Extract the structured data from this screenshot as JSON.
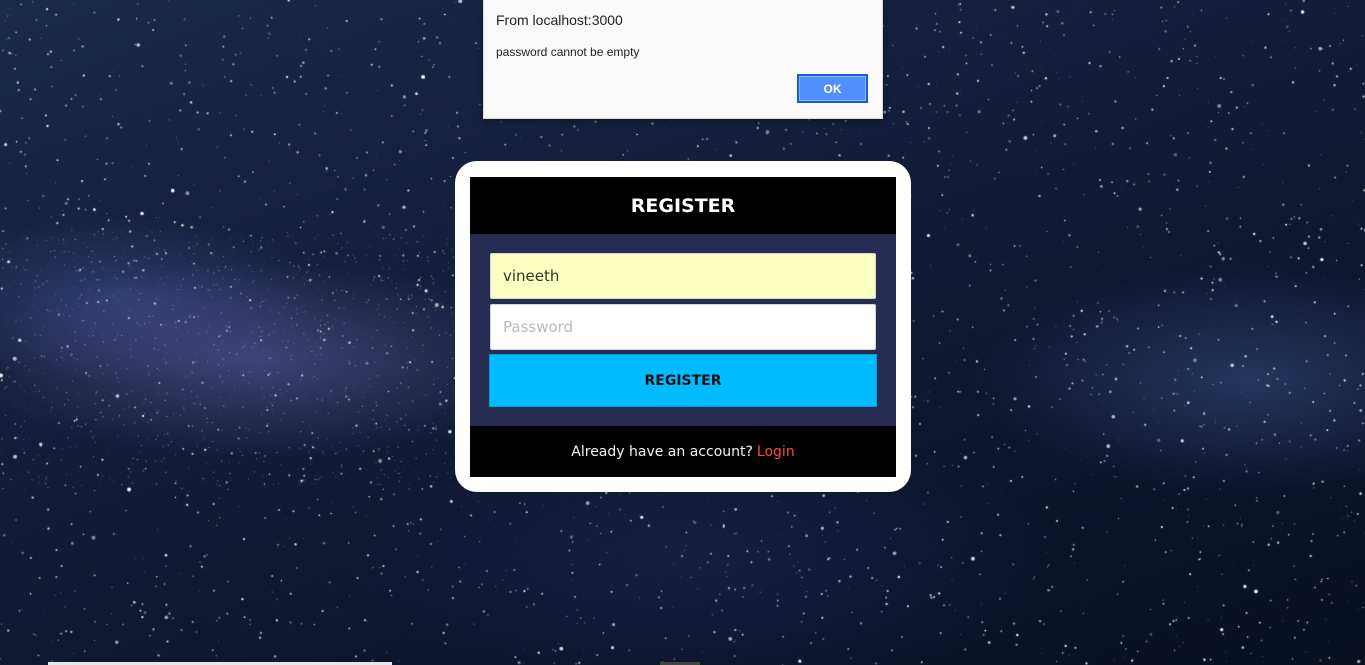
{
  "alert": {
    "title": "From localhost:3000",
    "message": "password cannot be empty",
    "ok_label": "OK"
  },
  "register_card": {
    "title": "REGISTER",
    "username_value": "vineeth",
    "password_placeholder": "Password",
    "submit_label": "REGISTER",
    "footer_text": "Already have an account?",
    "login_link": "Login"
  },
  "colors": {
    "header_bg": "#000000",
    "body_bg": "#262c52",
    "button_bg": "#00bbff",
    "autofill_bg": "#fbffc0",
    "link": "#ff4a36",
    "alert_ok": "#4d90fe"
  }
}
